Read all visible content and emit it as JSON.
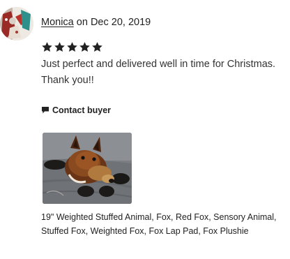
{
  "review": {
    "reviewer_name": "Monica",
    "date_text": "on Dec 20, 2019",
    "rating": 5,
    "rating_max": 5,
    "text_lines": [
      "Just perfect and delivered well in time for Christmas.",
      "Thank you!!"
    ],
    "contact_label": "Contact buyer",
    "listing_title_lines": [
      "19\" Weighted Stuffed Animal, Fox, Red Fox, Sensory Animal,",
      "Stuffed Fox, Weighted Fox, Fox Lap Pad, Fox Plushie"
    ]
  },
  "icons": {
    "avatar": "reviewer-avatar",
    "star": "star-icon",
    "contact": "flag-icon",
    "photo": "fox-plushie-photo"
  },
  "colors": {
    "text": "#222222",
    "body_text": "#333333",
    "star": "#222222"
  }
}
